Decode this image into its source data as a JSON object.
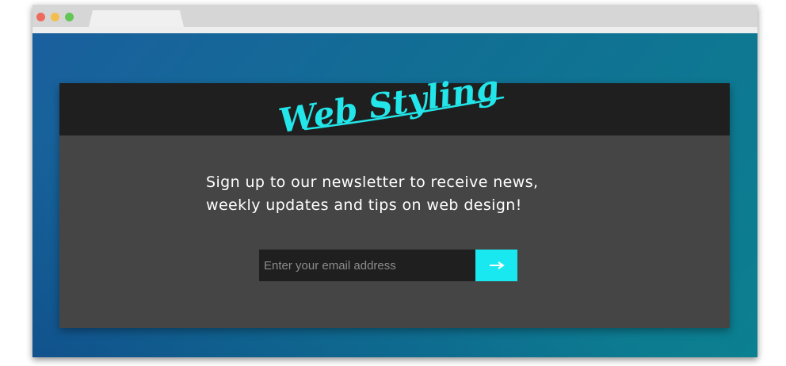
{
  "brand": {
    "logo_text": "Web Styling",
    "accent_color": "#22e6ea"
  },
  "newsletter": {
    "message_line_1": "Sign up to our newsletter to receive news,",
    "message_line_2": "weekly updates and tips on web design!",
    "email_placeholder": "Enter your email address",
    "email_value": "",
    "submit_icon": "arrow-right-icon"
  }
}
